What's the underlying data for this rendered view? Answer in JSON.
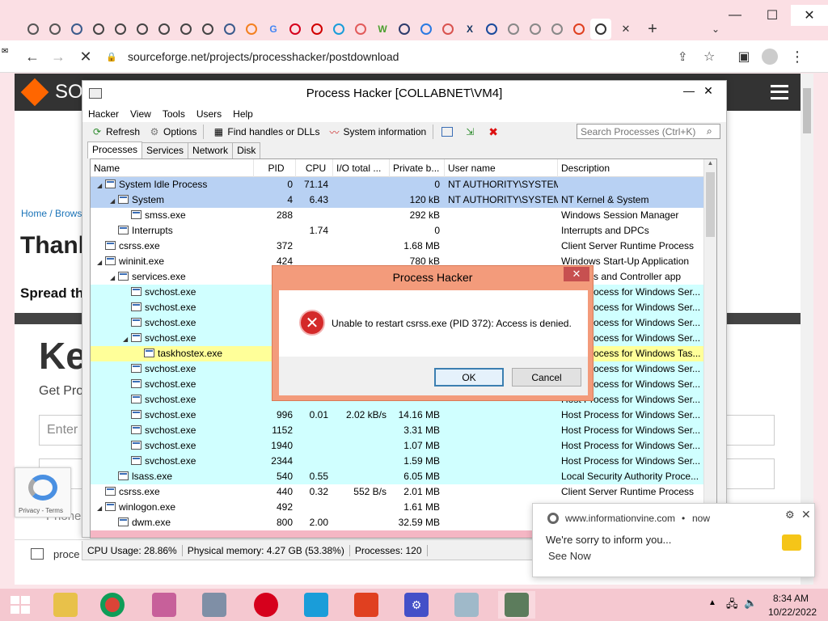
{
  "browser": {
    "url": "sourceforge.net/projects/processhacker/postdownload",
    "tabs": [
      {
        "icon": "chrome-icon",
        "label": "",
        "color": "#555"
      },
      {
        "icon": "search-icon",
        "label": "",
        "color": "#555"
      },
      {
        "icon": "shield-icon",
        "label": "",
        "color": "#3b5b8c"
      },
      {
        "icon": "globe-icon",
        "label": "",
        "color": "#444"
      },
      {
        "icon": "chrome-icon",
        "label": "",
        "color": "#444"
      },
      {
        "icon": "globe-icon",
        "label": "",
        "color": "#444"
      },
      {
        "icon": "timer-icon",
        "label": "",
        "color": "#444"
      },
      {
        "icon": "chrome-icon",
        "label": "",
        "color": "#444"
      },
      {
        "icon": "chrome-icon",
        "label": "",
        "color": "#444"
      },
      {
        "icon": "shield-icon",
        "label": "",
        "color": "#3b5b8c"
      },
      {
        "icon": "cloud-icon",
        "label": "",
        "color": "#f38020"
      },
      {
        "icon": "google-icon",
        "label": "G",
        "color": "#4285f4"
      },
      {
        "icon": "opera-icon",
        "label": "",
        "color": "#d6001c"
      },
      {
        "icon": "adobe-icon",
        "label": "",
        "color": "#d10000"
      },
      {
        "icon": "app-icon",
        "label": "",
        "color": "#1a9dd9"
      },
      {
        "icon": "lips-icon",
        "label": "",
        "color": "#e25b5b"
      },
      {
        "icon": "word-icon",
        "label": "W",
        "color": "#4a9f2d"
      },
      {
        "icon": "shield-icon",
        "label": "",
        "color": "#2d3b6b"
      },
      {
        "icon": "send-icon",
        "label": "",
        "color": "#2a7ae2"
      },
      {
        "icon": "atom-icon",
        "label": "",
        "color": "#d9534f"
      },
      {
        "icon": "x-icon",
        "label": "X",
        "color": "#12345f"
      },
      {
        "icon": "play-icon",
        "label": "",
        "color": "#1a4a9c"
      },
      {
        "icon": "search-icon",
        "label": "",
        "color": "#888"
      },
      {
        "icon": "search-icon",
        "label": "",
        "color": "#888"
      },
      {
        "icon": "search-icon",
        "label": "",
        "color": "#888"
      },
      {
        "icon": "office-icon",
        "label": "",
        "color": "#e04020"
      },
      {
        "icon": "tools-icon",
        "label": "",
        "color": "#333"
      }
    ]
  },
  "page": {
    "brand": "SO",
    "breadcrumb": "Home / Brows",
    "thanks": "Thank",
    "spread": "Spread th",
    "ke": "Ke",
    "getpro": "Get Pro",
    "enter": "Enter",
    "phone": "Phone",
    "proce": "proce",
    "recaptcha": "Privacy - Terms"
  },
  "ph": {
    "title": "Process Hacker [COLLABNET\\VM4]",
    "menu": [
      "Hacker",
      "View",
      "Tools",
      "Users",
      "Help"
    ],
    "toolbar": {
      "refresh": "Refresh",
      "options": "Options",
      "find": "Find handles or DLLs",
      "sysinfo": "System information"
    },
    "search_placeholder": "Search Processes (Ctrl+K)",
    "tabs": [
      "Processes",
      "Services",
      "Network",
      "Disk"
    ],
    "columns": [
      "Name",
      "PID",
      "CPU",
      "I/O total ...",
      "Private b...",
      "User name",
      "Description"
    ],
    "rows": [
      {
        "indent": 1,
        "exp": "◢",
        "name": "System Idle Process",
        "pid": "0",
        "cpu": "71.14",
        "io": "",
        "priv": "0",
        "user": "NT AUTHORITY\\SYSTEM",
        "desc": "",
        "bg": "#b8d1f3"
      },
      {
        "indent": 2,
        "exp": "◢",
        "name": "System",
        "pid": "4",
        "cpu": "6.43",
        "io": "",
        "priv": "120 kB",
        "user": "NT AUTHORITY\\SYSTEM",
        "desc": "NT Kernel & System",
        "bg": "#b8d1f3"
      },
      {
        "indent": 3,
        "exp": "",
        "name": "smss.exe",
        "pid": "288",
        "cpu": "",
        "io": "",
        "priv": "292 kB",
        "user": "",
        "desc": "Windows Session Manager",
        "bg": "#ffffff"
      },
      {
        "indent": 2,
        "exp": "",
        "name": "Interrupts",
        "pid": "",
        "cpu": "1.74",
        "io": "",
        "priv": "0",
        "user": "",
        "desc": "Interrupts and DPCs",
        "bg": "#ffffff"
      },
      {
        "indent": 1,
        "exp": "",
        "name": "csrss.exe",
        "pid": "372",
        "cpu": "",
        "io": "",
        "priv": "1.68 MB",
        "user": "",
        "desc": "Client Server Runtime Process",
        "bg": "#ffffff"
      },
      {
        "indent": 1,
        "exp": "◢",
        "name": "wininit.exe",
        "pid": "424",
        "cpu": "",
        "io": "",
        "priv": "780 kB",
        "user": "",
        "desc": "Windows Start-Up Application",
        "bg": "#ffffff"
      },
      {
        "indent": 2,
        "exp": "◢",
        "name": "services.exe",
        "pid": "",
        "cpu": "",
        "io": "",
        "priv": "",
        "user": "",
        "desc": "Services and Controller app",
        "bg": "#ffffff"
      },
      {
        "indent": 3,
        "exp": "",
        "name": "svchost.exe",
        "pid": "",
        "cpu": "",
        "io": "",
        "priv": "",
        "user": "",
        "desc": "Host Process for Windows Ser...",
        "bg": "#d0ffff"
      },
      {
        "indent": 3,
        "exp": "",
        "name": "svchost.exe",
        "pid": "",
        "cpu": "",
        "io": "",
        "priv": "",
        "user": "",
        "desc": "Host Process for Windows Ser...",
        "bg": "#d0ffff"
      },
      {
        "indent": 3,
        "exp": "",
        "name": "svchost.exe",
        "pid": "",
        "cpu": "",
        "io": "",
        "priv": "",
        "user": "",
        "desc": "Host Process for Windows Ser...",
        "bg": "#d0ffff"
      },
      {
        "indent": 3,
        "exp": "◢",
        "name": "svchost.exe",
        "pid": "",
        "cpu": "",
        "io": "",
        "priv": "",
        "user": "",
        "desc": "Host Process for Windows Ser...",
        "bg": "#d0ffff"
      },
      {
        "indent": 4,
        "exp": "",
        "name": "taskhostex.exe",
        "pid": "",
        "cpu": "",
        "io": "",
        "priv": "",
        "user": "",
        "desc": "Host Process for Windows Tas...",
        "bg": "#ffff99"
      },
      {
        "indent": 3,
        "exp": "",
        "name": "svchost.exe",
        "pid": "",
        "cpu": "",
        "io": "",
        "priv": "",
        "user": "",
        "desc": "Host Process for Windows Ser...",
        "bg": "#d0ffff"
      },
      {
        "indent": 3,
        "exp": "",
        "name": "svchost.exe",
        "pid": "",
        "cpu": "",
        "io": "",
        "priv": "",
        "user": "",
        "desc": "Host Process for Windows Ser...",
        "bg": "#d0ffff"
      },
      {
        "indent": 3,
        "exp": "",
        "name": "svchost.exe",
        "pid": "",
        "cpu": "",
        "io": "",
        "priv": "",
        "user": "",
        "desc": "Host Process for Windows Ser...",
        "bg": "#d0ffff"
      },
      {
        "indent": 3,
        "exp": "",
        "name": "svchost.exe",
        "pid": "996",
        "cpu": "0.01",
        "io": "2.02 kB/s",
        "priv": "14.16 MB",
        "user": "",
        "desc": "Host Process for Windows Ser...",
        "bg": "#d0ffff"
      },
      {
        "indent": 3,
        "exp": "",
        "name": "svchost.exe",
        "pid": "1152",
        "cpu": "",
        "io": "",
        "priv": "3.31 MB",
        "user": "",
        "desc": "Host Process for Windows Ser...",
        "bg": "#d0ffff"
      },
      {
        "indent": 3,
        "exp": "",
        "name": "svchost.exe",
        "pid": "1940",
        "cpu": "",
        "io": "",
        "priv": "1.07 MB",
        "user": "",
        "desc": "Host Process for Windows Ser...",
        "bg": "#d0ffff"
      },
      {
        "indent": 3,
        "exp": "",
        "name": "svchost.exe",
        "pid": "2344",
        "cpu": "",
        "io": "",
        "priv": "1.59 MB",
        "user": "",
        "desc": "Host Process for Windows Ser...",
        "bg": "#d0ffff"
      },
      {
        "indent": 2,
        "exp": "",
        "name": "lsass.exe",
        "pid": "540",
        "cpu": "0.55",
        "io": "",
        "priv": "6.05 MB",
        "user": "",
        "desc": "Local Security Authority Proce...",
        "bg": "#d0ffff"
      },
      {
        "indent": 1,
        "exp": "",
        "name": "csrss.exe",
        "pid": "440",
        "cpu": "0.32",
        "io": "552 B/s",
        "priv": "2.01 MB",
        "user": "",
        "desc": "Client Server Runtime Process",
        "bg": "#ffffff"
      },
      {
        "indent": 1,
        "exp": "◢",
        "name": "winlogon.exe",
        "pid": "492",
        "cpu": "",
        "io": "",
        "priv": "1.61 MB",
        "user": "",
        "desc": "",
        "bg": "#ffffff"
      },
      {
        "indent": 2,
        "exp": "",
        "name": "dwm.exe",
        "pid": "800",
        "cpu": "2.00",
        "io": "",
        "priv": "32.59 MB",
        "user": "",
        "desc": "",
        "bg": "#ffffff"
      }
    ],
    "status": {
      "cpu": "CPU Usage: 28.86%",
      "mem": "Physical memory: 4.27 GB (53.38%)",
      "procs": "Processes: 120"
    }
  },
  "dialog": {
    "title": "Process Hacker",
    "message": "Unable to restart csrss.exe (PID 372): Access is denied.",
    "ok": "OK",
    "cancel": "Cancel"
  },
  "notification": {
    "site": "www.informationvine.com",
    "sep": "•",
    "time": "now",
    "text": "We're sorry to inform you...",
    "action": "See Now"
  },
  "taskbar": {
    "time": "8:34 AM",
    "date": "10/22/2022"
  }
}
